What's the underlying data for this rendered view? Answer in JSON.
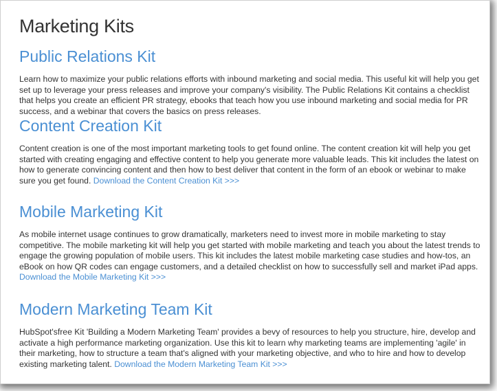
{
  "page": {
    "title": "Marketing Kits"
  },
  "kits": [
    {
      "title": "Public Relations Kit",
      "body": "Learn how to maximize your public relations efforts with inbound marketing and social media. This useful kit will help you get set up to leverage your press releases and improve your company's visibility. The Public Relations Kit contains a checklist that helps you create an efficient PR strategy, ebooks that teach how you use inbound marketing and social media for PR success, and a webinar that covers the basics on press releases.",
      "link": ""
    },
    {
      "title": "Content Creation Kit",
      "body": "Content creation is one of the most important marketing tools to get found online. The content creation kit will help you get started with creating engaging and effective content to help you generate more valuable leads. This kit includes the latest on how to generate convincing content and then how to best deliver that content in the form of an ebook or webinar to make sure you get found. ",
      "link": "Download the Content Creation Kit >>>"
    },
    {
      "title": "Mobile Marketing Kit",
      "body": "As mobile internet usage continues to grow dramatically, marketers need to invest more in mobile marketing to stay competitive. The mobile marketing kit will help you get started with mobile marketing and teach you about the latest trends to engage the growing population of mobile users. This kit includes the latest mobile marketing case studies and how-tos, an eBook on how QR codes can engage customers, and a detailed checklist on how to successfully sell and market iPad apps. ",
      "link": "Download the Mobile Marketing Kit >>>"
    },
    {
      "title": "Modern Marketing Team Kit",
      "body": "HubSpot'sfree Kit 'Building a Modern Marketing Team' provides a bevy of resources to help you structure, hire, develop and activate a high performance marketing organization.  Use this kit to learn why marketing teams are implementing 'agile' in their marketing, how to structure a team that's aligned with your marketing objective, and who to hire and how to develop existing marketing talent. ",
      "link": "Download the Modern Marketing Team Kit >>>"
    }
  ],
  "colors": {
    "heading_blue": "#4a8fd3",
    "body_text": "#333333"
  }
}
